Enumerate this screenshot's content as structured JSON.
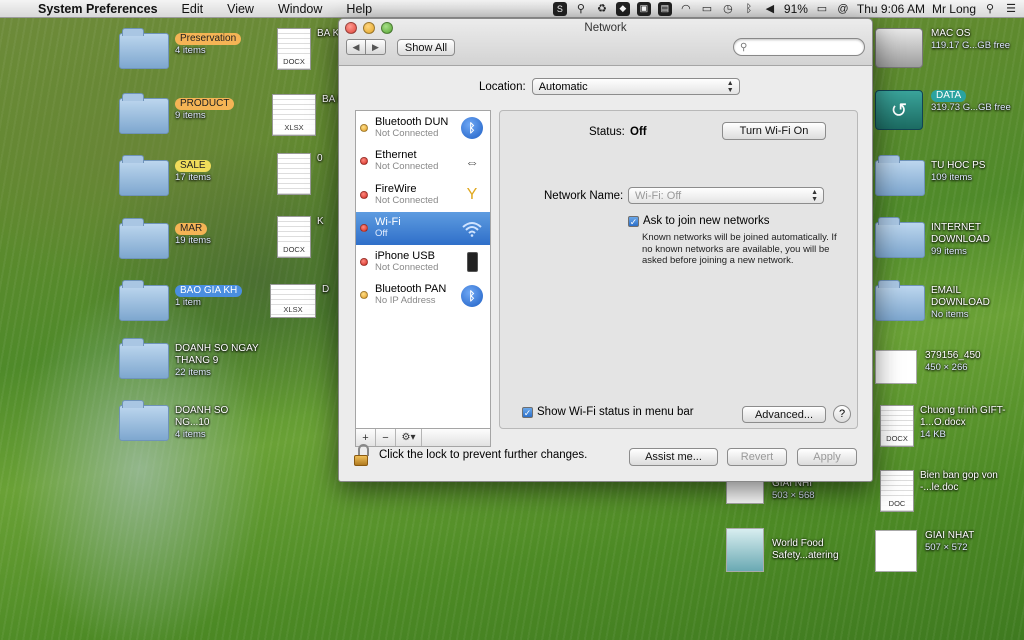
{
  "menubar": {
    "app_name": "System Preferences",
    "menus": [
      "Edit",
      "View",
      "Window",
      "Help"
    ],
    "battery": "91%",
    "clock": "Thu 9:06 AM",
    "user": "Mr Long"
  },
  "desktop_left": [
    {
      "name": "Preservation",
      "sub": "4 items",
      "tag": "orange"
    },
    {
      "name": "PRODUCT",
      "sub": "9 items",
      "tag": "orange"
    },
    {
      "name": "SALE",
      "sub": "17 items",
      "tag": "yellow"
    },
    {
      "name": "MAR",
      "sub": "19 items",
      "tag": "orange"
    },
    {
      "name": "BAO GIA KH",
      "sub": "1 item",
      "tag": "blue"
    },
    {
      "name": "DOANH SO NGAY THANG 9",
      "sub": "22 items",
      "tag": ""
    },
    {
      "name": "DOANH SO NG...10",
      "sub": "4 items",
      "tag": ""
    }
  ],
  "desktop_docs": [
    {
      "ext": "DOCX",
      "label": "BA K"
    },
    {
      "ext": "XLSX",
      "label": "BA K"
    },
    {
      "ext": "",
      "label": "0"
    },
    {
      "ext": "DOCX",
      "label": "K"
    },
    {
      "ext": "XLSX",
      "label": "D"
    }
  ],
  "desktop_right": [
    {
      "name": "MAC OS",
      "sub": "119.17 G...GB free",
      "kind": "drive"
    },
    {
      "name": "DATA",
      "sub": "319.73 G...GB free",
      "kind": "tm"
    },
    {
      "name": "TU HOC PS",
      "sub": "109 items",
      "kind": "folder"
    },
    {
      "name": "INTERNET DOWNLOAD",
      "sub": "99 items",
      "kind": "folder"
    },
    {
      "name": "EMAIL DOWNLOAD",
      "sub": "No items",
      "kind": "folder"
    },
    {
      "name": "379156_450",
      "sub": "450 × 266",
      "kind": "thumb"
    },
    {
      "name": "Chuong trinh GIFT-1...O.docx",
      "sub": "14 KB",
      "kind": "doc",
      "ext": "DOCX"
    },
    {
      "name": "Bien ban gop von -...le.doc",
      "sub": "",
      "kind": "doc",
      "ext": "DOC"
    },
    {
      "name": "GIAI NHAT",
      "sub": "507 × 572",
      "kind": "thumb"
    }
  ],
  "desktop_mid": [
    {
      "name": "GIAI NHI",
      "sub": "503 × 568"
    },
    {
      "name": "World Food Safety...atering",
      "sub": ""
    }
  ],
  "window": {
    "title": "Network",
    "show_all": "Show All",
    "location_label": "Location:",
    "location_value": "Automatic",
    "services": [
      {
        "name": "Bluetooth DUN",
        "status": "Not Connected",
        "dot": "yellow",
        "icon": "bluetooth-icon"
      },
      {
        "name": "Ethernet",
        "status": "Not Connected",
        "dot": "red",
        "icon": "ethernet-icon"
      },
      {
        "name": "FireWire",
        "status": "Not Connected",
        "dot": "red",
        "icon": "firewire-icon"
      },
      {
        "name": "Wi-Fi",
        "status": "Off",
        "dot": "red",
        "icon": "wifi-icon",
        "selected": true
      },
      {
        "name": "iPhone USB",
        "status": "Not Connected",
        "dot": "red",
        "icon": "iphone-icon"
      },
      {
        "name": "Bluetooth PAN",
        "status": "No IP Address",
        "dot": "yellow",
        "icon": "bluetooth-icon"
      }
    ],
    "status_label": "Status:",
    "status_value": "Off",
    "turn_wifi_button": "Turn Wi-Fi On",
    "network_name_label": "Network Name:",
    "network_name_value": "Wi-Fi: Off",
    "ask_join_label": "Ask to join new networks",
    "ask_join_note": "Known networks will be joined automatically. If no known networks are available, you will be asked before joining a new network.",
    "show_status_label": "Show Wi-Fi status in menu bar",
    "advanced_button": "Advanced...",
    "help_button": "?",
    "lock_text": "Click the lock to prevent further changes.",
    "assist_button": "Assist me...",
    "revert_button": "Revert",
    "apply_button": "Apply"
  }
}
